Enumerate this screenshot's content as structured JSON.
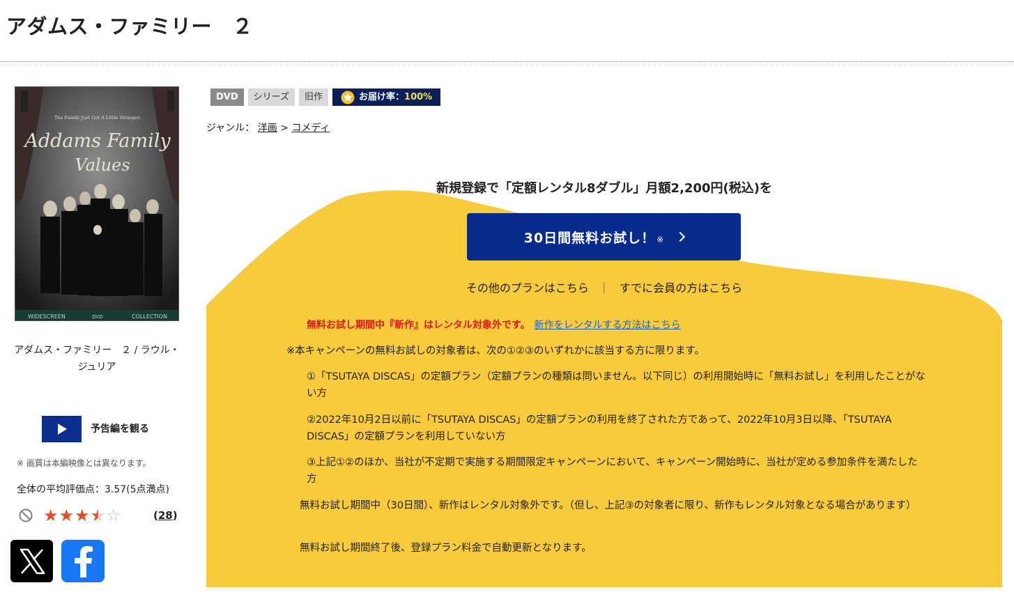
{
  "title": "アダムス・ファミリー　２",
  "poster": {
    "tagline": "The Family Just Got A Little Stranger.",
    "logo_line1": "Addams Family",
    "logo_line2": "Values",
    "footer_left": "WIDESCREEN",
    "footer_right": "COLLECTION",
    "footer_mid": "DVD"
  },
  "movie_caption": "アダムス・ファミリー　２ / ラウル・ジュリア",
  "trailer": {
    "label": "予告編を観る",
    "note": "※ 画質は本編映像とは異なります。"
  },
  "rating": {
    "label": "全体の平均評価点：",
    "score_text": "3.57(5点満点)",
    "score": 3.57,
    "max": 5,
    "count": "28",
    "count_open": "(",
    "count_close": ")"
  },
  "social": {
    "x_icon": "x-logo-icon",
    "facebook_icon": "facebook-logo-icon"
  },
  "badges": {
    "format": "DVD",
    "series": "シリーズ",
    "old": "旧作",
    "delivery_label": "お届け率：",
    "delivery_rate": "100%"
  },
  "genre": {
    "label": "ジャンル：",
    "level1": "洋画",
    "separator": ">",
    "level2": "コメディ"
  },
  "campaign": {
    "headline": "新規登録で「定額レンタル8ダブル」月額2,200円(税込)を",
    "trial_button": "30日間無料お試し！",
    "trial_mark": "※",
    "other_plans": "その他のプランはこちら",
    "separator": "｜",
    "member_login": "すでに会員の方はこちら",
    "warning": "無料お試し期間中『新作』はレンタル対象外です。",
    "new_release_link": "新作をレンタルする方法はこちら",
    "eligibility": "※本キャンペーンの無料お試しの対象者は、次の①②③のいずれかに該当する方に限ります。",
    "conditions": [
      "①「TSUTAYA DISCAS」の定額プラン（定額プランの種類は問いません。以下同じ）の利用開始時に「無料お試し」を利用したことがない方",
      "②2022年10月2日以前に「TSUTAYA DISCAS」の定額プランの利用を終了された方であって、2022年10月3日以降、「TSUTAYA DISCAS」の定額プランを利用していない方",
      "③上記①②のほか、当社が不定期で実施する期間限定キャンペーンにおいて、キャンペーン開始時に、当社が定める参加条件を満たした方"
    ],
    "note_period": "無料お試し期間中（30日間）、新作はレンタル対象外です。（但し、上記③の対象者に限り、新作もレンタル対象となる場合があります）",
    "note_renew": "無料お試し期間終了後、登録プラン料金で自動更新となります。"
  },
  "colors": {
    "campaign_yellow": "#f8cb3c",
    "primary_blue": "#0a2b8e",
    "delivery_navy": "#0c1f5a",
    "warning_red": "#e3151a",
    "link_blue": "#1a63c7",
    "star_red": "#ea4a2a"
  }
}
